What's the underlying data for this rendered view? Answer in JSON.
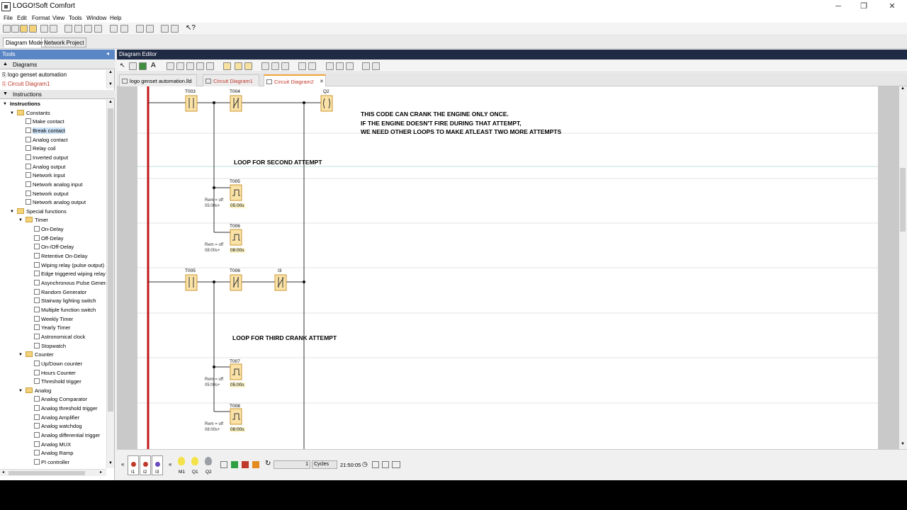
{
  "window": {
    "title": "LOGO!Soft Comfort",
    "minimize": "─",
    "maximize": "❐",
    "close": "✕"
  },
  "menu": [
    "File",
    "Edit",
    "Format",
    "View",
    "Tools",
    "Window",
    "Help"
  ],
  "modes": [
    "Diagram Mode",
    "Network Project"
  ],
  "left": {
    "tools_label": "Tools",
    "diagrams_label": "Diagrams",
    "diagrams": [
      "logo genset automation",
      "Circuit Diagram1"
    ],
    "instructions_label": "Instructions",
    "tree": [
      {
        "label": "Instructions",
        "level": 0,
        "kind": "root"
      },
      {
        "label": "Constants",
        "level": 1,
        "kind": "folder"
      },
      {
        "label": "Make contact",
        "level": 2,
        "kind": "item"
      },
      {
        "label": "Break contact",
        "level": 2,
        "kind": "item",
        "selected": true
      },
      {
        "label": "Analog contact",
        "level": 2,
        "kind": "item"
      },
      {
        "label": "Relay coil",
        "level": 2,
        "kind": "item"
      },
      {
        "label": "Inverted output",
        "level": 2,
        "kind": "item"
      },
      {
        "label": "Analog output",
        "level": 2,
        "kind": "item"
      },
      {
        "label": "Network input",
        "level": 2,
        "kind": "item"
      },
      {
        "label": "Network analog input",
        "level": 2,
        "kind": "item"
      },
      {
        "label": "Network output",
        "level": 2,
        "kind": "item"
      },
      {
        "label": "Network analog output",
        "level": 2,
        "kind": "item"
      },
      {
        "label": "Special functions",
        "level": 1,
        "kind": "folder"
      },
      {
        "label": "Timer",
        "level": 2,
        "kind": "folder"
      },
      {
        "label": "On-Delay",
        "level": 3,
        "kind": "item"
      },
      {
        "label": "Off-Delay",
        "level": 3,
        "kind": "item"
      },
      {
        "label": "On-/Off-Delay",
        "level": 3,
        "kind": "item"
      },
      {
        "label": "Retentive On-Delay",
        "level": 3,
        "kind": "item"
      },
      {
        "label": "Wiping relay (pulse output)",
        "level": 3,
        "kind": "item"
      },
      {
        "label": "Edge triggered wiping relay",
        "level": 3,
        "kind": "item"
      },
      {
        "label": "Asynchronous Pulse Generator",
        "level": 3,
        "kind": "item"
      },
      {
        "label": "Random Generator",
        "level": 3,
        "kind": "item"
      },
      {
        "label": "Stairway lighting switch",
        "level": 3,
        "kind": "item"
      },
      {
        "label": "Multiple function switch",
        "level": 3,
        "kind": "item"
      },
      {
        "label": "Weekly Timer",
        "level": 3,
        "kind": "item"
      },
      {
        "label": "Yearly Timer",
        "level": 3,
        "kind": "item"
      },
      {
        "label": "Astronomical clock",
        "level": 3,
        "kind": "item"
      },
      {
        "label": "Stopwatch",
        "level": 3,
        "kind": "item"
      },
      {
        "label": "Counter",
        "level": 2,
        "kind": "folder"
      },
      {
        "label": "Up/Down counter",
        "level": 3,
        "kind": "item"
      },
      {
        "label": "Hours Counter",
        "level": 3,
        "kind": "item"
      },
      {
        "label": "Threshold trigger",
        "level": 3,
        "kind": "item"
      },
      {
        "label": "Analog",
        "level": 2,
        "kind": "folder"
      },
      {
        "label": "Analog Comparator",
        "level": 3,
        "kind": "item"
      },
      {
        "label": "Analog threshold trigger",
        "level": 3,
        "kind": "item"
      },
      {
        "label": "Analog Amplifier",
        "level": 3,
        "kind": "item"
      },
      {
        "label": "Analog watchdog",
        "level": 3,
        "kind": "item"
      },
      {
        "label": "Analog differential trigger",
        "level": 3,
        "kind": "item"
      },
      {
        "label": "Analog MUX",
        "level": 3,
        "kind": "item"
      },
      {
        "label": "Analog Ramp",
        "level": 3,
        "kind": "item"
      },
      {
        "label": "PI controller",
        "level": 3,
        "kind": "item"
      }
    ]
  },
  "editor": {
    "title": "Diagram Editor",
    "tabs": [
      {
        "label": "logo genset automation.lld",
        "active": false,
        "color": "#000000"
      },
      {
        "label": "Circuit Diagram1",
        "active": false,
        "color": "#c0392b"
      },
      {
        "label": "Circuit Diagram2",
        "active": true,
        "color": "#c0392b"
      }
    ],
    "tab_close": "✕"
  },
  "diagram": {
    "notes": {
      "line1": "THIS CODE CAN CRANK THE ENGINE ONLY ONCE.",
      "line2": "IF THE ENGINE DOESN'T FIRE DURING THAT ATTEMPT,",
      "line3": "WE NEED OTHER LOOPS TO MAKE ATLEAST TWO MORE ATTEMPTS",
      "loop2": "LOOP FOR SECOND ATTEMPT",
      "loop3": "LOOP FOR THIRD CRANK ATTEMPT"
    },
    "labels": {
      "t003": "T003",
      "t004": "T004",
      "q2": "Q2",
      "t005": "T005",
      "t006": "T006",
      "t005b": "T005",
      "t006b": "T006",
      "i3": "I3",
      "t007": "T007",
      "t008": "T008"
    },
    "rem": "Rem = off",
    "timers": [
      {
        "name": "T005",
        "param": "05:00s+",
        "display": "05:00s"
      },
      {
        "name": "T006",
        "param": "08:00s+",
        "display": "08:00s"
      },
      {
        "name": "T007",
        "param": "05:00s+",
        "display": "05:00s"
      },
      {
        "name": "T008",
        "param": "08:00s+",
        "display": "08:00s"
      }
    ]
  },
  "sim": {
    "inputs": [
      "I1",
      "I2",
      "I3"
    ],
    "outputs": [
      "M1",
      "Q1",
      "Q2"
    ],
    "steps": "1",
    "cycles_label": "Cycles",
    "time": "21:50:05"
  },
  "colors": {
    "rail": "#c0171a",
    "block_fill": "#fbe3a8",
    "block_stroke": "#c8962f",
    "wire": "#333333",
    "editor_header": "#1f2a44"
  }
}
